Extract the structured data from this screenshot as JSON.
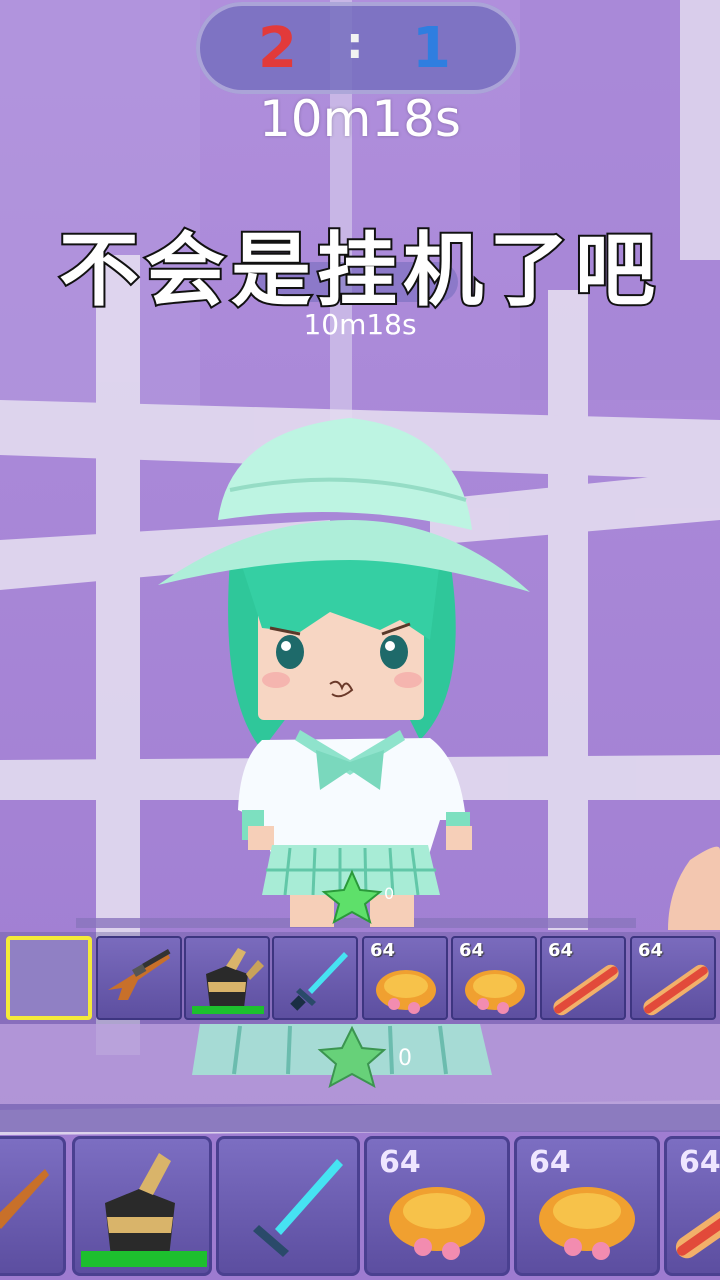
{
  "scoreboard": {
    "red_score": "2",
    "separator": ":",
    "blue_score": "1"
  },
  "timer": {
    "main": "10m18s",
    "echo": "10m18s"
  },
  "caption": "不会是挂机了吧",
  "colors": {
    "wall": "#a683d4",
    "grid": "#e3dcf0",
    "character_hair": "#3fd3a6",
    "hat": "#b8f2df",
    "slot_selected": "#f4ea3a",
    "durability": "#1dbf2e"
  },
  "character": {
    "badge_count": "0"
  },
  "hotbar": {
    "slots": [
      {
        "item": "empty",
        "count": ""
      },
      {
        "item": "rifle-icon",
        "count": ""
      },
      {
        "item": "armor-chestplate-icon",
        "count": ""
      },
      {
        "item": "crystal-sword-icon",
        "count": ""
      },
      {
        "item": "roast-chicken-icon",
        "count": "64"
      },
      {
        "item": "roast-chicken-icon",
        "count": "64"
      },
      {
        "item": "baguette-icon",
        "count": "64"
      },
      {
        "item": "baguette-icon",
        "count": "64"
      }
    ]
  },
  "zoomed_hotbar": {
    "counts": [
      "64",
      "64",
      "64"
    ],
    "badge_count": "0"
  }
}
